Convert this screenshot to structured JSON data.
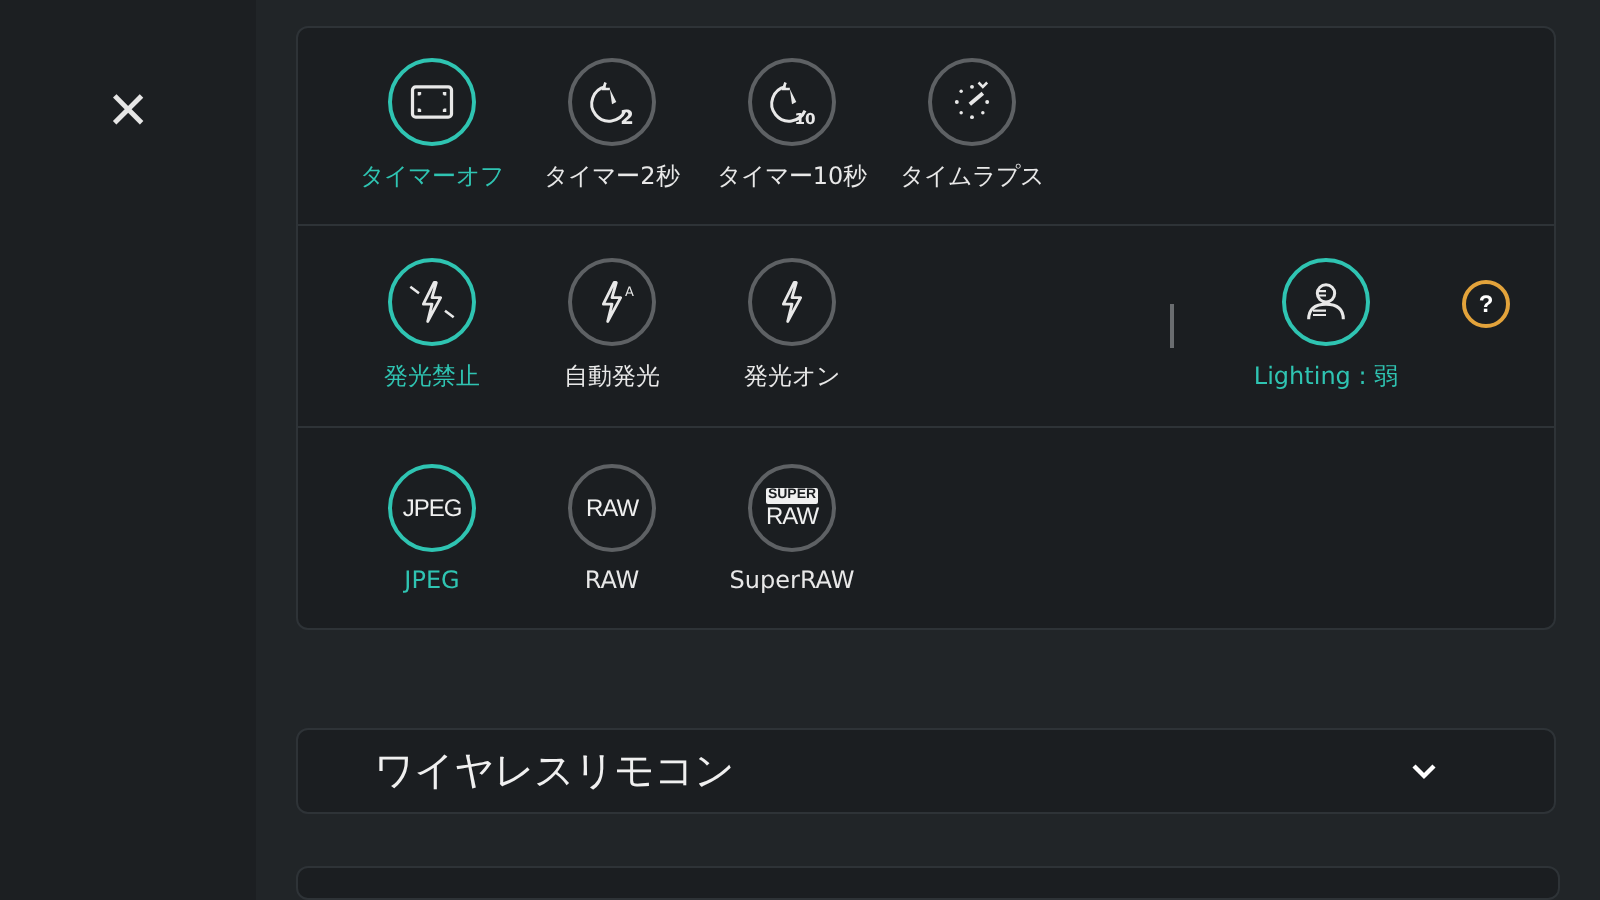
{
  "close_button": {
    "icon": "×"
  },
  "settings_card": {
    "rows": [
      {
        "kind": "options",
        "options": [
          {
            "kind": "timer_off",
            "label": "タイマーオフ",
            "selected": true
          },
          {
            "kind": "timer",
            "icon_text": "2",
            "label": "タイマー2秒",
            "selected": false
          },
          {
            "kind": "timer",
            "icon_text": "10",
            "label": "タイマー10秒",
            "selected": false
          },
          {
            "kind": "timelapse",
            "label": "タイムラプス",
            "selected": false
          }
        ]
      },
      {
        "kind": "options",
        "options": [
          {
            "kind": "flash_off",
            "label": "発光禁止",
            "selected": true
          },
          {
            "kind": "flash",
            "icon_text": "A",
            "label": "自動発光",
            "selected": false
          },
          {
            "kind": "flash",
            "label": "発光オン",
            "selected": false
          }
        ],
        "lighting": {
          "label": "Lighting : 弱",
          "selected": true
        },
        "help": {
          "icon": "?"
        }
      },
      {
        "kind": "options",
        "options": [
          {
            "kind": "format",
            "icon_text": "JPEG",
            "label": "JPEG",
            "selected": true
          },
          {
            "kind": "format",
            "icon_text": "RAW",
            "label": "RAW",
            "selected": false
          },
          {
            "kind": "super",
            "icon_text": "SUPER",
            "icon_text_2": "RAW",
            "label": "SuperRAW",
            "selected": false
          }
        ]
      }
    ]
  },
  "wireless_remote": {
    "title": "ワイヤレスリモコン",
    "expanded": false
  }
}
